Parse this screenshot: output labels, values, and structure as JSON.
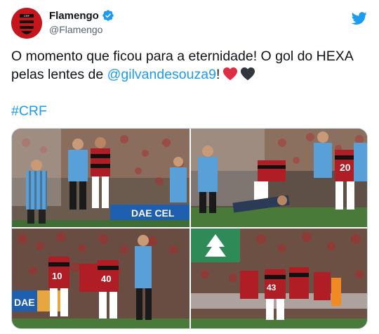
{
  "account": {
    "display_name": "Flamengo",
    "handle": "@Flamengo",
    "verified": true,
    "avatar_icon": "flamengo-crest-icon"
  },
  "platform_icon": "twitter-bird-icon",
  "tweet": {
    "text_part1": "O momento que ficou para a eternidade! O gol do HEXA pelas lentes de ",
    "mention": "@gilvandesouza9",
    "text_part2": "!",
    "emojis": [
      "red-heart",
      "black-heart"
    ],
    "hashtag": "#CRF"
  },
  "media": {
    "photos": [
      {
        "name": "photo-1",
        "caption_visible": "DAE CEL"
      },
      {
        "name": "photo-2",
        "caption_visible": ""
      },
      {
        "name": "photo-3",
        "caption_visible": "DAE"
      },
      {
        "name": "photo-4",
        "caption_visible": ""
      }
    ]
  },
  "colors": {
    "accent": "#1d9bf0",
    "text": "#0f1419",
    "secondary": "#536471",
    "flamengo_red": "#c4161c",
    "grass": "#4a7a3a"
  }
}
